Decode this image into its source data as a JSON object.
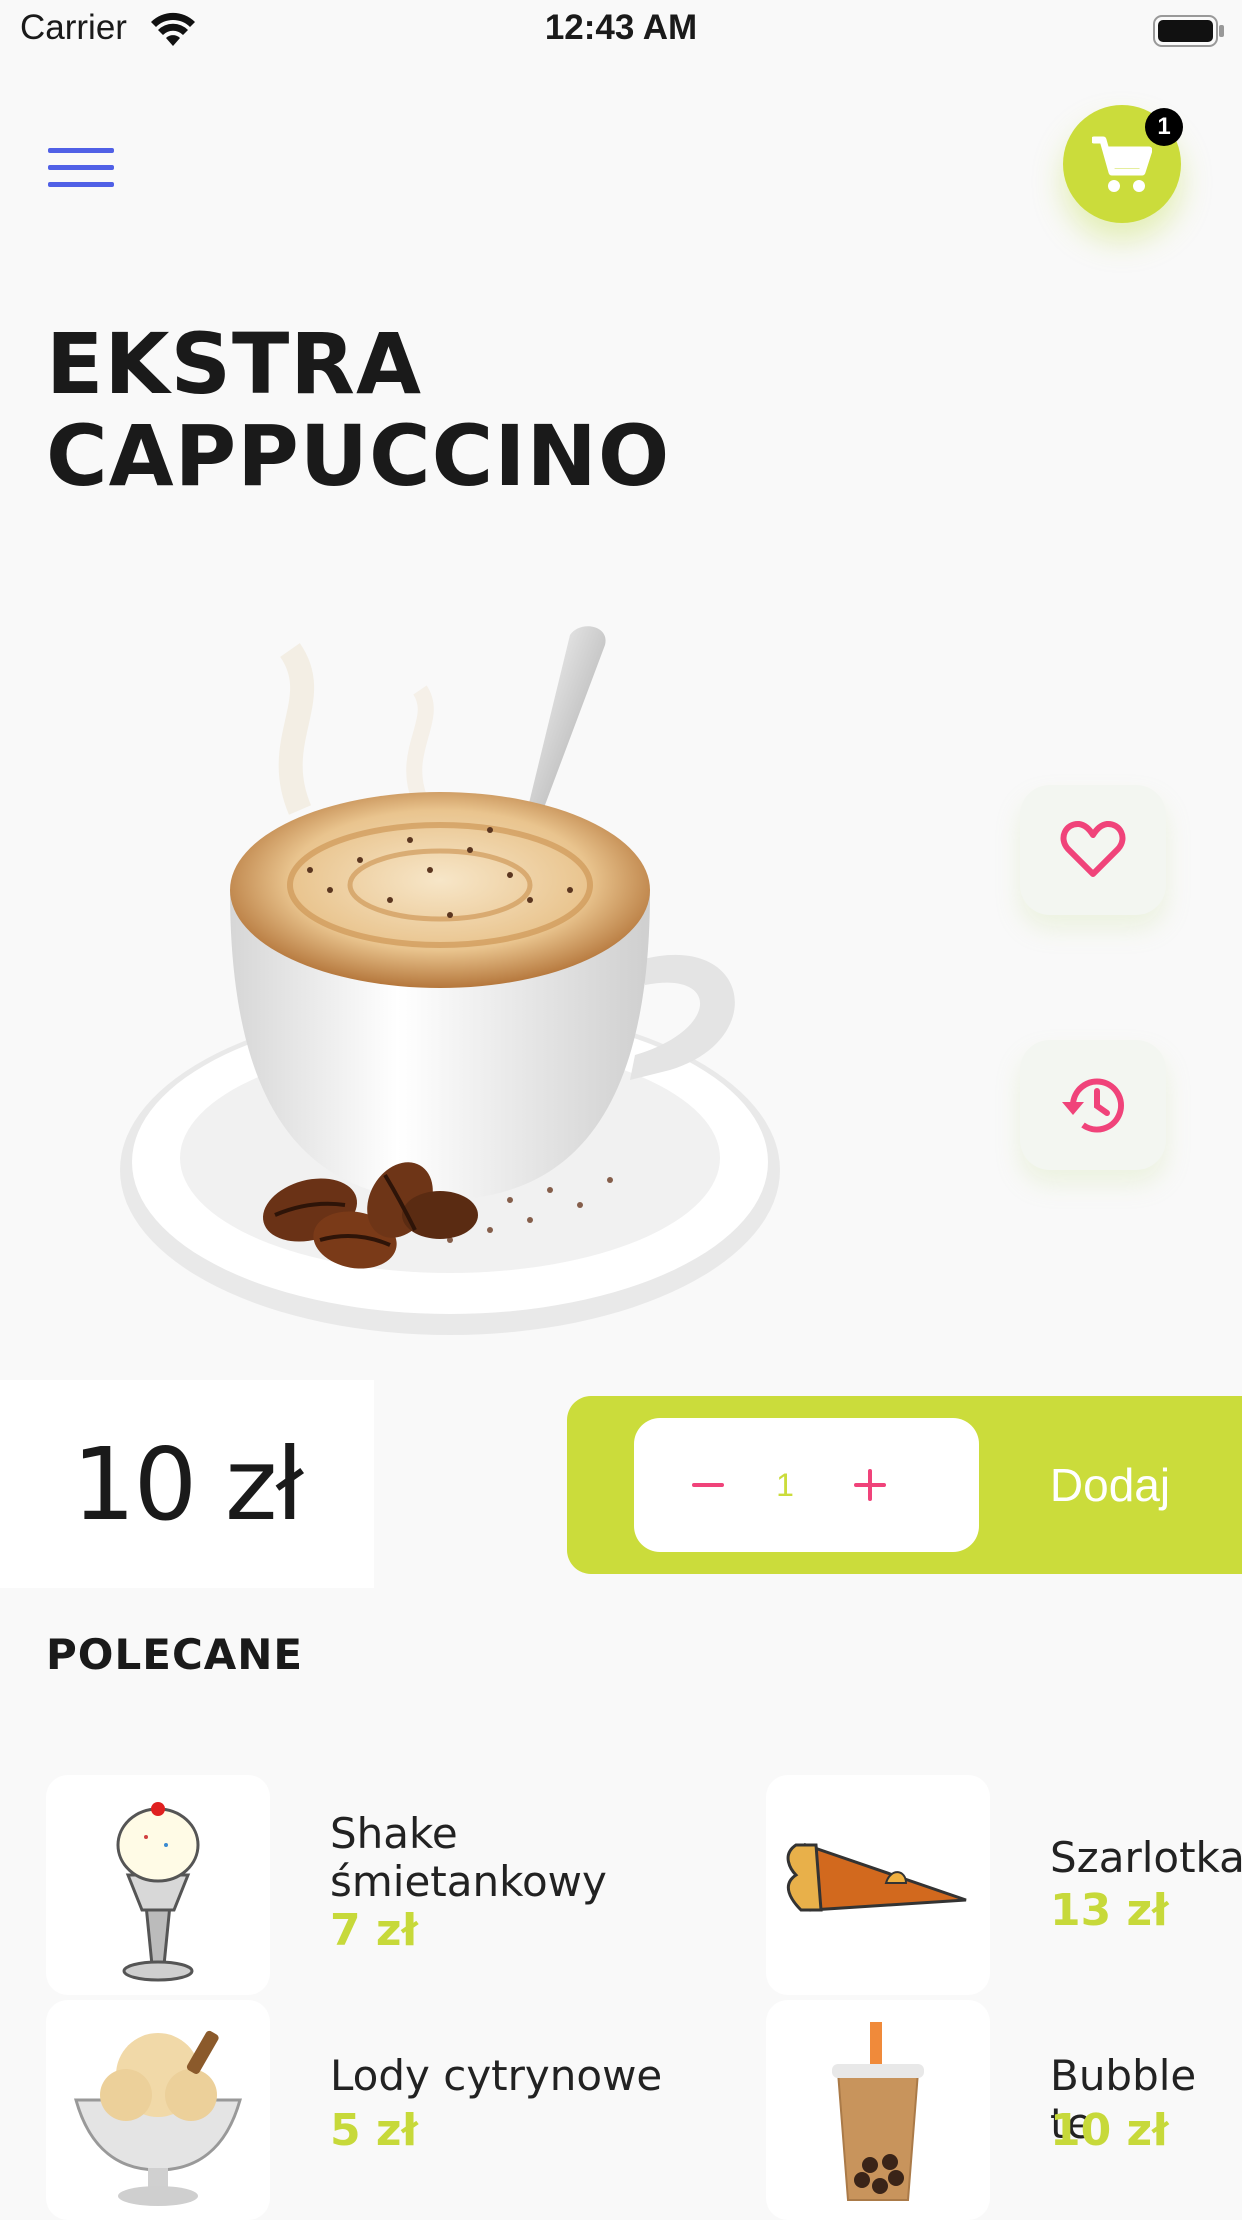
{
  "status_bar": {
    "carrier": "Carrier",
    "time": "12:43 AM"
  },
  "cart": {
    "count": "1"
  },
  "product": {
    "title_line1": "EKSTRA",
    "title_line2": "CAPPUCCINO",
    "price": "10 zł",
    "quantity": "1",
    "add_label": "Dodaj"
  },
  "recommended": {
    "title": "POLECANE",
    "items": [
      {
        "name_line1": "Shake",
        "name_line2": "śmietankowy",
        "price": "7 zł"
      },
      {
        "name_line1": "Szarlotka",
        "name_line2": "",
        "price": "13 zł"
      },
      {
        "name_line1": "Lody cytrynowe",
        "name_line2": "",
        "price": "5 zł"
      },
      {
        "name_line1": "Bubble te",
        "name_line2": "",
        "price": "10 zł"
      }
    ]
  },
  "colors": {
    "accent": "#cbdc3b",
    "pink": "#f0437a",
    "menu": "#5060e6"
  },
  "icons": [
    "menu-icon",
    "cart-icon",
    "heart-icon",
    "history-icon",
    "minus-icon",
    "plus-icon"
  ]
}
